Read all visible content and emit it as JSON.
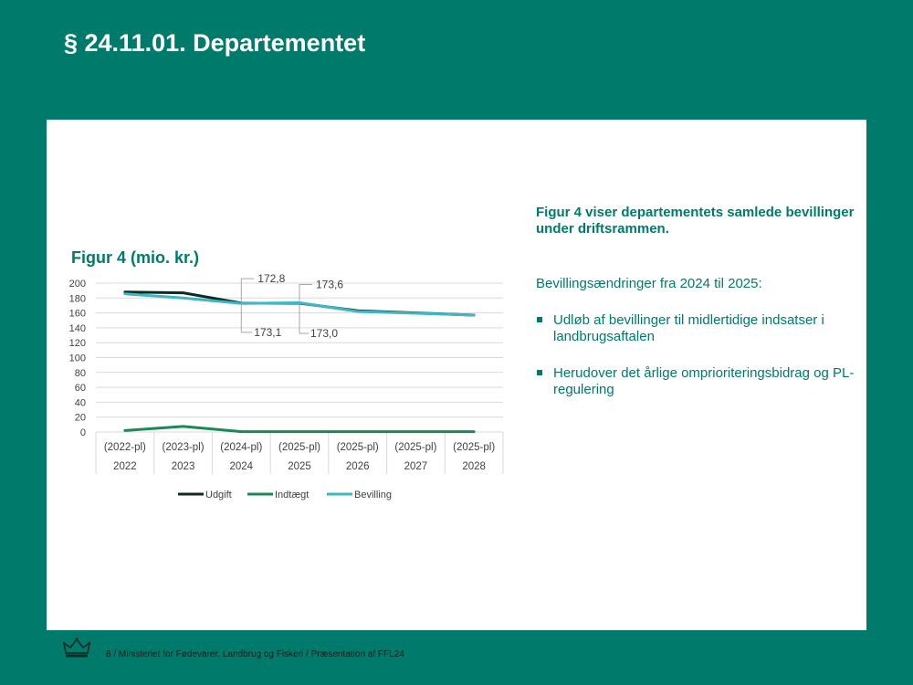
{
  "slide": {
    "title": "§ 24.11.01. Departementet"
  },
  "figure": {
    "title": "Figur 4 (mio. kr.)"
  },
  "chart_data": {
    "type": "line",
    "title": "",
    "xlabel": "",
    "ylabel": "",
    "ylim": [
      0,
      200
    ],
    "yticks": [
      0,
      20,
      40,
      60,
      80,
      100,
      120,
      140,
      160,
      180,
      200
    ],
    "grid": true,
    "legend_position": "bottom",
    "categories": [
      {
        "label": "(2022-pl)",
        "group": "2022"
      },
      {
        "label": "(2023-pl)",
        "group": "2023"
      },
      {
        "label": "(2024-pl)",
        "group": "2024"
      },
      {
        "label": "(2025-pl)",
        "group": "2025"
      },
      {
        "label": "(2025-pl)",
        "group": "2026"
      },
      {
        "label": "(2025-pl)",
        "group": "2027"
      },
      {
        "label": "(2025-pl)",
        "group": "2028"
      }
    ],
    "series": [
      {
        "name": "Udgift",
        "color": "#0d2b22",
        "values": [
          188,
          187,
          173.1,
          173.0,
          163,
          160,
          157
        ]
      },
      {
        "name": "Indtægt",
        "color": "#1a8a55",
        "values": [
          2,
          7.5,
          0.5,
          0.5,
          0.5,
          0.5,
          0.5
        ]
      },
      {
        "name": "Bevilling",
        "color": "#3db6c6",
        "values": [
          185.5,
          180,
          172.8,
          173.6,
          162,
          159.5,
          157
        ]
      }
    ],
    "data_labels": [
      {
        "text": "172,8",
        "series": "Bevilling",
        "index": 2
      },
      {
        "text": "173,6",
        "series": "Bevilling",
        "index": 3
      },
      {
        "text": "173,1",
        "series": "Udgift",
        "index": 2
      },
      {
        "text": "173,0",
        "series": "Udgift",
        "index": 3
      }
    ]
  },
  "side": {
    "heading": "Figur 4 viser departementets samlede bevillinger under driftsrammen.",
    "intro": "Bevillingsændringer fra 2024 til 2025:",
    "bullets": [
      "Udløb af bevillinger til midlertidige indsatser i landbrugsaftalen",
      "Herudover det årlige omprioriteringsbidrag og PL-regulering"
    ]
  },
  "footer": {
    "text": "8 / Ministeriet for Fødevarer, Landbrug og Fiskeri / Præsentation af FFL24",
    "logo_icon": "crown-icon"
  }
}
